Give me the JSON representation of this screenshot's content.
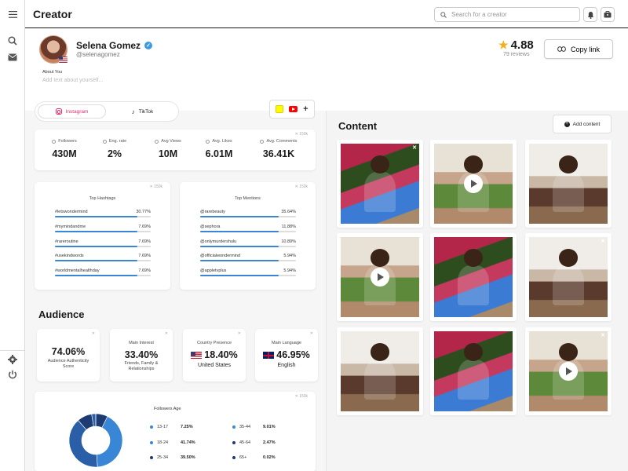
{
  "app": {
    "title": "Creator"
  },
  "search": {
    "placeholder": "Search for a creator"
  },
  "profile": {
    "name": "Selena Gomez",
    "handle": "@selenagomez",
    "about_label": "About You",
    "about_placeholder": "Add text about yourself...",
    "rating": "4.88",
    "reviews": "79 reviews",
    "copy_link": "Copy link"
  },
  "tabs": [
    {
      "label": "Instagram",
      "active": true
    },
    {
      "label": "TikTok",
      "active": false
    }
  ],
  "stats": [
    {
      "label": "Followers",
      "value": "430M",
      "icon": "user-icon"
    },
    {
      "label": "Eng. rate",
      "value": "2%",
      "icon": "engagement-icon"
    },
    {
      "label": "Avg Views",
      "value": "10M",
      "icon": "heart-icon"
    },
    {
      "label": "Avg. Likes",
      "value": "6.01M",
      "icon": "heart-icon"
    },
    {
      "label": "Avg. Comments",
      "value": "36.41K",
      "icon": "comment-icon"
    }
  ],
  "hashtags": {
    "title": "Top Hashtags",
    "items": [
      {
        "tag": "#letswondermind",
        "value": "30.77%",
        "fill": 0.86
      },
      {
        "tag": "#mymindandme",
        "value": "7.69%",
        "fill": 0.86
      },
      {
        "tag": "#rareroutine",
        "value": "7.69%",
        "fill": 0.86
      },
      {
        "tag": "#usekindwords",
        "value": "7.69%",
        "fill": 0.86
      },
      {
        "tag": "#worldmentalhealthday",
        "value": "7.69%",
        "fill": 0.86
      }
    ]
  },
  "mentions": {
    "title": "Top Mentions",
    "items": [
      {
        "tag": "@rarebeauty",
        "value": "35.64%",
        "fill": 0.82
      },
      {
        "tag": "@sephora",
        "value": "11.88%",
        "fill": 0.82
      },
      {
        "tag": "@onlymurdershulu",
        "value": "10.89%",
        "fill": 0.82
      },
      {
        "tag": "@officialwondermind",
        "value": "5.94%",
        "fill": 0.82
      },
      {
        "tag": "@appletvplus",
        "value": "5.94%",
        "fill": 0.82
      }
    ]
  },
  "audience": {
    "title": "Audience",
    "authenticity": {
      "value": "74.06%",
      "caption": "Audience Authenticity Score"
    },
    "interest": {
      "label": "Main Interest",
      "value": "33.40%",
      "sub": "Friends, Family & Relationships"
    },
    "country": {
      "label": "Country Presence",
      "value": "18.40%",
      "sub": "United States"
    },
    "language": {
      "label": "Main Language",
      "value": "46.95%",
      "sub": "English"
    }
  },
  "followers_age": {
    "title": "Followers Age",
    "rows": [
      {
        "range": "13-17",
        "pct": "7.25%",
        "color": "#3a86d6"
      },
      {
        "range": "35-44",
        "pct": "9.01%",
        "color": "#3a86d6"
      },
      {
        "range": "18-24",
        "pct": "41.74%",
        "color": "#3a86d6"
      },
      {
        "range": "45-64",
        "pct": "2.47%",
        "color": "#1d3b73"
      },
      {
        "range": "25-34",
        "pct": "39.50%",
        "color": "#1d3b73"
      },
      {
        "range": "65+",
        "pct": "0.02%",
        "color": "#1d3b73"
      }
    ]
  },
  "chart_data": {
    "type": "pie",
    "categories": [
      "13-17",
      "18-24",
      "25-34",
      "35-44",
      "45-64",
      "65+"
    ],
    "values": [
      7.25,
      41.74,
      39.5,
      9.01,
      2.47,
      0.02
    ],
    "colors": [
      "#1d3b73",
      "#3a86d6",
      "#2a5fa8",
      "#1d3b73",
      "#2a5fa8",
      "#3a86d6"
    ]
  },
  "content": {
    "title": "Content",
    "add_label": "Add content",
    "tiles": [
      {
        "scene": "s1",
        "play": false,
        "close": true
      },
      {
        "scene": "s2",
        "play": true,
        "close": false
      },
      {
        "scene": "s3",
        "play": false,
        "close": false
      },
      {
        "scene": "s2",
        "play": true,
        "close": false
      },
      {
        "scene": "s1",
        "play": false,
        "close": false
      },
      {
        "scene": "s3",
        "play": false,
        "close": true
      },
      {
        "scene": "s3",
        "play": false,
        "close": false
      },
      {
        "scene": "s1",
        "play": false,
        "close": false
      },
      {
        "scene": "s2",
        "play": true,
        "close": true
      }
    ]
  }
}
